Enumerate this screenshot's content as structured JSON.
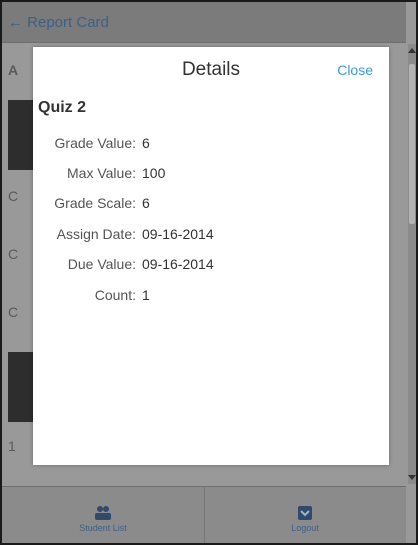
{
  "header": {
    "back_label": "← Report Card"
  },
  "background_peek": {
    "row_a": "A",
    "row_c1": "C",
    "row_c2": "C",
    "row_c3": "C",
    "row_1": "1"
  },
  "modal": {
    "title": "Details",
    "close_label": "Close",
    "item_title": "Quiz 2",
    "fields": [
      {
        "label": "Grade Value:",
        "value": "6"
      },
      {
        "label": "Max Value:",
        "value": "100"
      },
      {
        "label": "Grade Scale:",
        "value": "6"
      },
      {
        "label": "Assign Date:",
        "value": "09-16-2014"
      },
      {
        "label": "Due Value:",
        "value": "09-16-2014"
      },
      {
        "label": "Count:",
        "value": "1"
      }
    ]
  },
  "footer": {
    "student_list_label": "Student List",
    "logout_label": "Logout"
  },
  "colors": {
    "accent": "#3a9cd6",
    "link_dimmed": "#3d5f8a",
    "overlay": "#999999"
  }
}
